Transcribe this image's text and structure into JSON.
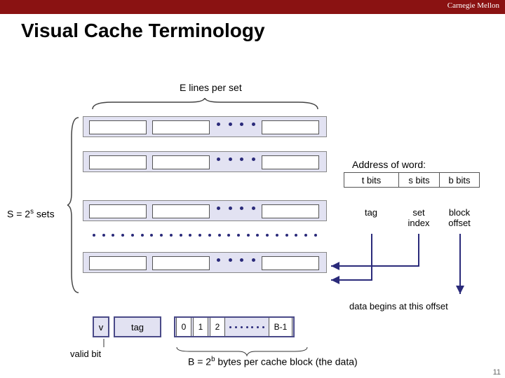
{
  "brand": "Carnegie Mellon",
  "title": "Visual Cache Terminology",
  "lines_per_set": "E lines per set",
  "sets_label_prefix": "S = 2",
  "sets_label_sup": "s",
  "sets_label_suffix": " sets",
  "address_of_word": "Address of word:",
  "addr": {
    "t": "t bits",
    "s": "s bits",
    "b": "b bits",
    "tag": "tag",
    "set_index": "set\nindex",
    "block_offset": "block\noffset"
  },
  "offset_note": "data begins at this offset",
  "line": {
    "v": "v",
    "tag": "tag",
    "b0": "0",
    "b1": "1",
    "b2": "2",
    "blast": "B-1"
  },
  "valid_bit": "valid bit",
  "bytes_label_prefix": "B = 2",
  "bytes_label_sup": "b",
  "bytes_label_suffix": " bytes per cache block (the data)",
  "pagenum": "11"
}
